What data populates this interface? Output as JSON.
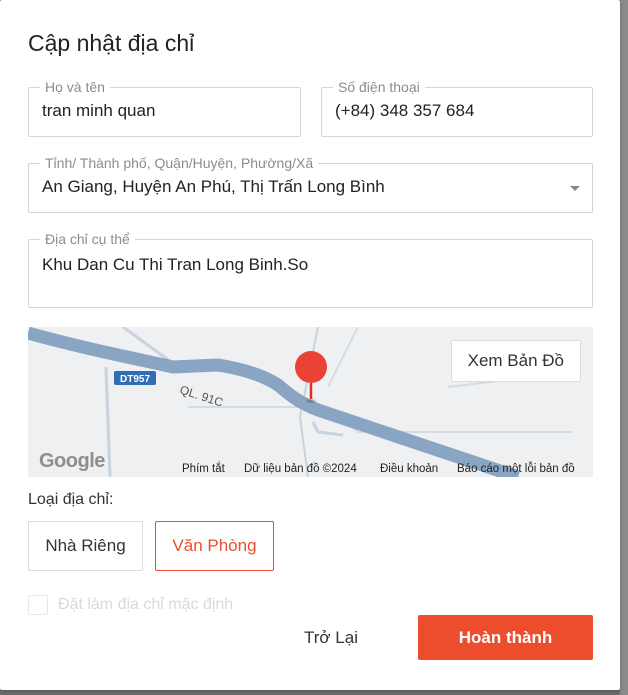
{
  "dialog": {
    "title": "Cập nhật địa chỉ"
  },
  "form": {
    "name": {
      "label": "Họ và tên",
      "value": "tran minh quan"
    },
    "phone": {
      "label": "Số điện thoại",
      "value": "(+84) 348 357 684"
    },
    "region": {
      "label": "Tỉnh/ Thành phố, Quận/Huyện, Phường/Xã",
      "value": "An Giang, Huyện An Phú, Thị Trấn Long Bình"
    },
    "detail": {
      "label": "Địa chỉ cụ thể",
      "value": "Khu Dan Cu Thi Tran Long Binh.So"
    }
  },
  "map": {
    "view_button": "Xem Bản Đồ",
    "road_labels": {
      "dt": "DT957",
      "ql": "QL. 91C"
    },
    "logo": "Google",
    "footer": {
      "shortcuts": "Phím tắt",
      "map_data": "Dữ liệu bản đồ ©2024",
      "terms": "Điều khoản",
      "report": "Báo cáo một lỗi bản đồ"
    },
    "colors": {
      "road": "#8aa4c4",
      "pin": "#ea4335",
      "background": "#eef0f2"
    }
  },
  "address_type": {
    "label": "Loại địa chỉ:",
    "options": [
      "Nhà Riêng",
      "Văn Phòng"
    ],
    "selected": "Văn Phòng"
  },
  "default_checkbox": {
    "label": "Đặt làm địa chỉ mặc định",
    "checked": false,
    "disabled": true
  },
  "actions": {
    "back": "Trở Lại",
    "submit": "Hoàn thành"
  },
  "colors": {
    "accent": "#ee4d2d"
  }
}
